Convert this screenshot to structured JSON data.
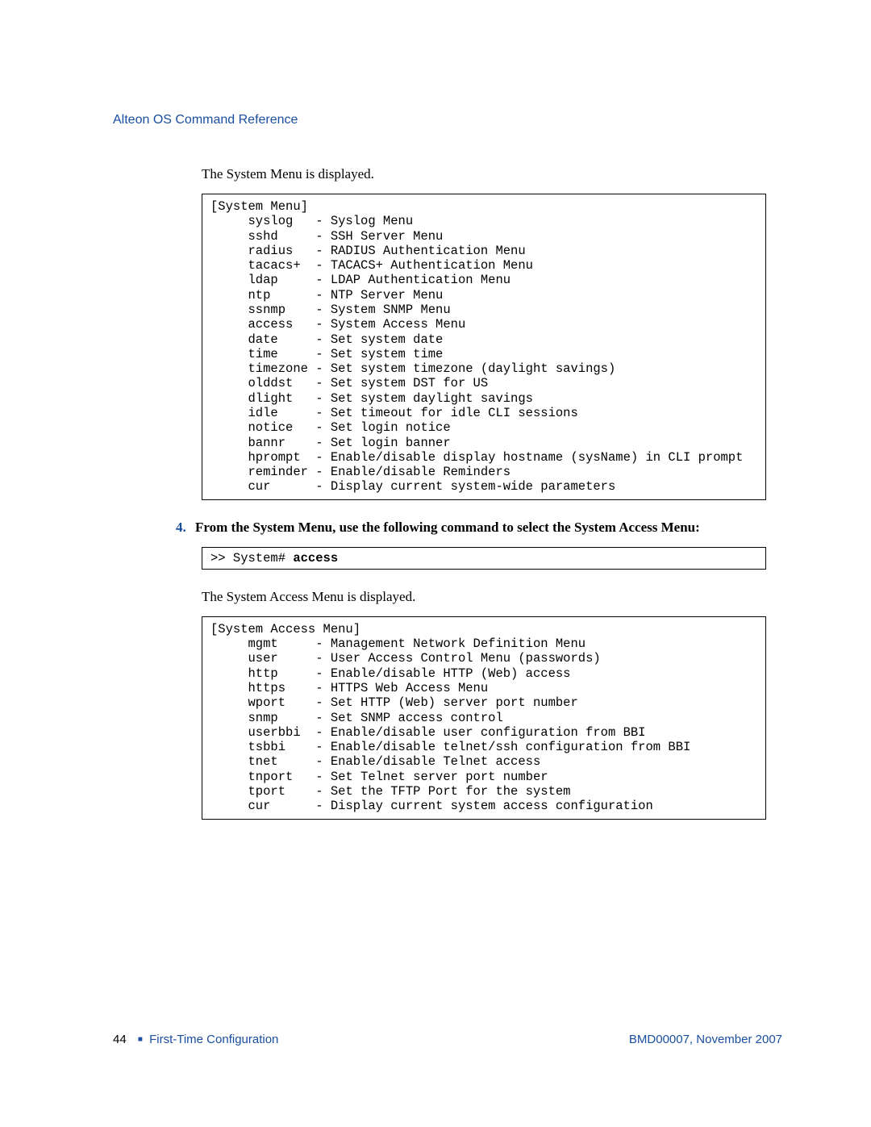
{
  "header": {
    "title": "Alteon OS Command Reference"
  },
  "intro1": "The System Menu is displayed.",
  "systemMenu": {
    "title": "[System Menu]",
    "items": [
      {
        "cmd": "syslog",
        "desc": "Syslog Menu"
      },
      {
        "cmd": "sshd",
        "desc": "SSH Server Menu"
      },
      {
        "cmd": "radius",
        "desc": "RADIUS Authentication Menu"
      },
      {
        "cmd": "tacacs+",
        "desc": "TACACS+ Authentication Menu"
      },
      {
        "cmd": "ldap",
        "desc": "LDAP Authentication Menu"
      },
      {
        "cmd": "ntp",
        "desc": "NTP Server Menu"
      },
      {
        "cmd": "ssnmp",
        "desc": "System SNMP Menu"
      },
      {
        "cmd": "access",
        "desc": "System Access Menu"
      },
      {
        "cmd": "date",
        "desc": "Set system date"
      },
      {
        "cmd": "time",
        "desc": "Set system time"
      },
      {
        "cmd": "timezone",
        "desc": "Set system timezone (daylight savings)"
      },
      {
        "cmd": "olddst",
        "desc": "Set system DST for US"
      },
      {
        "cmd": "dlight",
        "desc": "Set system daylight savings"
      },
      {
        "cmd": "idle",
        "desc": "Set timeout for idle CLI sessions"
      },
      {
        "cmd": "notice",
        "desc": "Set login notice"
      },
      {
        "cmd": "bannr",
        "desc": "Set login banner"
      },
      {
        "cmd": "hprompt",
        "desc": "Enable/disable display hostname (sysName) in CLI prompt"
      },
      {
        "cmd": "reminder",
        "desc": "Enable/disable Reminders"
      },
      {
        "cmd": "cur",
        "desc": "Display current system-wide parameters"
      }
    ]
  },
  "step": {
    "num": "4.",
    "text": "From the System Menu, use the following command to select the System Access Menu:"
  },
  "cmdBox": {
    "prompt": ">> System# ",
    "command": "access"
  },
  "intro2": "The System Access Menu is displayed.",
  "accessMenu": {
    "title": "[System Access Menu]",
    "items": [
      {
        "cmd": "mgmt",
        "desc": "Management Network Definition Menu"
      },
      {
        "cmd": "user",
        "desc": "User Access Control Menu (passwords)"
      },
      {
        "cmd": "http",
        "desc": "Enable/disable HTTP (Web) access"
      },
      {
        "cmd": "https",
        "desc": "HTTPS Web Access Menu"
      },
      {
        "cmd": "wport",
        "desc": "Set HTTP (Web) server port number"
      },
      {
        "cmd": "snmp",
        "desc": "Set SNMP access control"
      },
      {
        "cmd": "userbbi",
        "desc": "Enable/disable user configuration from BBI"
      },
      {
        "cmd": "tsbbi",
        "desc": "Enable/disable telnet/ssh configuration from BBI"
      },
      {
        "cmd": "tnet",
        "desc": "Enable/disable Telnet access"
      },
      {
        "cmd": "tnport",
        "desc": "Set Telnet server port number"
      },
      {
        "cmd": "tport",
        "desc": "Set the TFTP Port for the system"
      },
      {
        "cmd": "cur",
        "desc": "Display current system access configuration"
      }
    ]
  },
  "footer": {
    "pageNumber": "44",
    "chapter": "First-Time Configuration",
    "docRef": "BMD00007, November 2007"
  }
}
